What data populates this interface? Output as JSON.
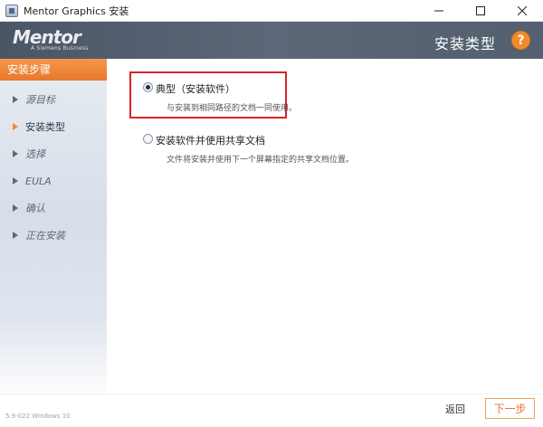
{
  "window": {
    "title": "Mentor Graphics 安装",
    "minimize_glyph": "—",
    "maximize_glyph": "☐",
    "close_glyph": "✕"
  },
  "header": {
    "logo_word": "Mentor",
    "logo_sub": "A Siemens Business",
    "title": "安装类型",
    "help_label": "?"
  },
  "sidebar": {
    "heading": "安装步骤",
    "items": [
      {
        "label": "源目标"
      },
      {
        "label": "安装类型"
      },
      {
        "label": "选择"
      },
      {
        "label": "EULA"
      },
      {
        "label": "确认"
      },
      {
        "label": "正在安装"
      }
    ],
    "active_index": 1
  },
  "options": [
    {
      "label": "典型（安装软件）",
      "description": "与安装到相同路径的文档一同使用。",
      "selected": true
    },
    {
      "label": "安装软件并使用共享文档",
      "description": "文件将安装并使用下一个屏幕指定的共享文档位置。",
      "selected": false
    }
  ],
  "footer": {
    "version": "5.9-022 Windows 10",
    "back_label": "返回",
    "next_label": "下一步"
  },
  "colors": {
    "accent": "#f08a2c",
    "header_bg": "#525e6e",
    "highlight": "#d9242a"
  }
}
